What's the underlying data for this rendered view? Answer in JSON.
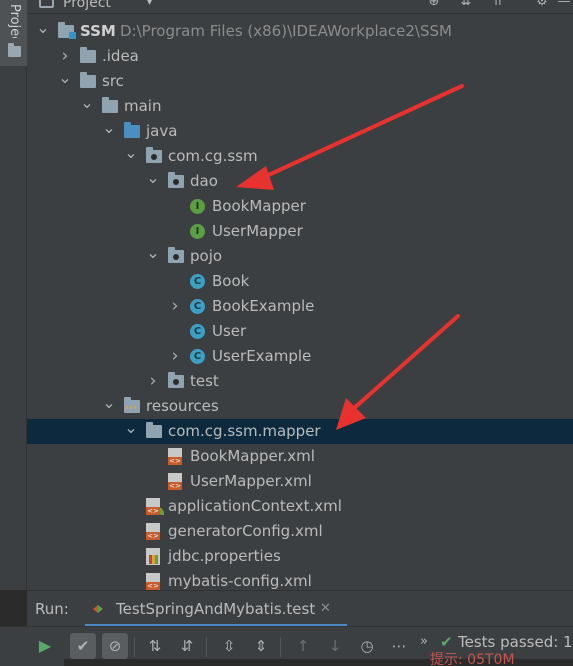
{
  "strip": {
    "label": "Project"
  },
  "panel": {
    "title": "Project"
  },
  "tree": [
    {
      "id": "ssm",
      "depth": 0,
      "chevron": "expanded",
      "icon": "module-folder",
      "label": "SSM",
      "bold": true,
      "path": "D:\\Program Files (x86)\\IDEAWorkplace2\\SSM"
    },
    {
      "id": "idea",
      "depth": 1,
      "chevron": "collapsed",
      "icon": "folder",
      "label": ".idea"
    },
    {
      "id": "src",
      "depth": 1,
      "chevron": "expanded",
      "icon": "folder",
      "label": "src"
    },
    {
      "id": "main",
      "depth": 2,
      "chevron": "expanded",
      "icon": "folder",
      "label": "main"
    },
    {
      "id": "java",
      "depth": 3,
      "chevron": "expanded",
      "icon": "source-folder",
      "label": "java"
    },
    {
      "id": "com-cg-ssm",
      "depth": 4,
      "chevron": "expanded",
      "icon": "package",
      "label": "com.cg.ssm"
    },
    {
      "id": "dao",
      "depth": 5,
      "chevron": "expanded",
      "icon": "package",
      "label": "dao"
    },
    {
      "id": "bookmapper",
      "depth": 6,
      "chevron": "none",
      "icon": "interface",
      "label": "BookMapper"
    },
    {
      "id": "usermapper",
      "depth": 6,
      "chevron": "none",
      "icon": "interface",
      "label": "UserMapper"
    },
    {
      "id": "pojo",
      "depth": 5,
      "chevron": "expanded",
      "icon": "package",
      "label": "pojo"
    },
    {
      "id": "book",
      "depth": 6,
      "chevron": "none",
      "icon": "class",
      "label": "Book"
    },
    {
      "id": "bookexample",
      "depth": 6,
      "chevron": "collapsed",
      "icon": "class",
      "label": "BookExample"
    },
    {
      "id": "user",
      "depth": 6,
      "chevron": "none",
      "icon": "class",
      "label": "User"
    },
    {
      "id": "userexample",
      "depth": 6,
      "chevron": "collapsed",
      "icon": "class",
      "label": "UserExample"
    },
    {
      "id": "test",
      "depth": 5,
      "chevron": "collapsed",
      "icon": "package",
      "label": "test"
    },
    {
      "id": "resources",
      "depth": 3,
      "chevron": "expanded",
      "icon": "resources-folder",
      "label": "resources"
    },
    {
      "id": "mapper-pkg",
      "depth": 4,
      "chevron": "expanded",
      "icon": "folder",
      "label": "com.cg.ssm.mapper",
      "selected": true
    },
    {
      "id": "bookmapper-xml",
      "depth": 5,
      "chevron": "none",
      "icon": "xml",
      "label": "BookMapper.xml"
    },
    {
      "id": "usermapper-xml",
      "depth": 5,
      "chevron": "none",
      "icon": "xml",
      "label": "UserMapper.xml"
    },
    {
      "id": "appcontext-xml",
      "depth": 4,
      "chevron": "none",
      "icon": "spring-xml",
      "label": "applicationContext.xml"
    },
    {
      "id": "generator-xml",
      "depth": 4,
      "chevron": "none",
      "icon": "xml",
      "label": "generatorConfig.xml"
    },
    {
      "id": "jdbc-props",
      "depth": 4,
      "chevron": "none",
      "icon": "properties",
      "label": "jdbc.properties"
    },
    {
      "id": "mybatis-xml",
      "depth": 4,
      "chevron": "none",
      "icon": "xml",
      "label": "mybatis-config.xml"
    }
  ],
  "run": {
    "label": "Run:",
    "tab_label": "TestSpringAndMybatis.test",
    "close_glyph": "✕"
  },
  "toolbar": {
    "status_text": "Tests passed: 1"
  },
  "console": {
    "partial_text": "提示: 05T0M"
  },
  "colors": {
    "selection": "#0d293e",
    "arrow": "#e8322f",
    "class_icon": "#3d9fc4",
    "interface_icon": "#5b9e43",
    "pass_green": "#59a869"
  }
}
